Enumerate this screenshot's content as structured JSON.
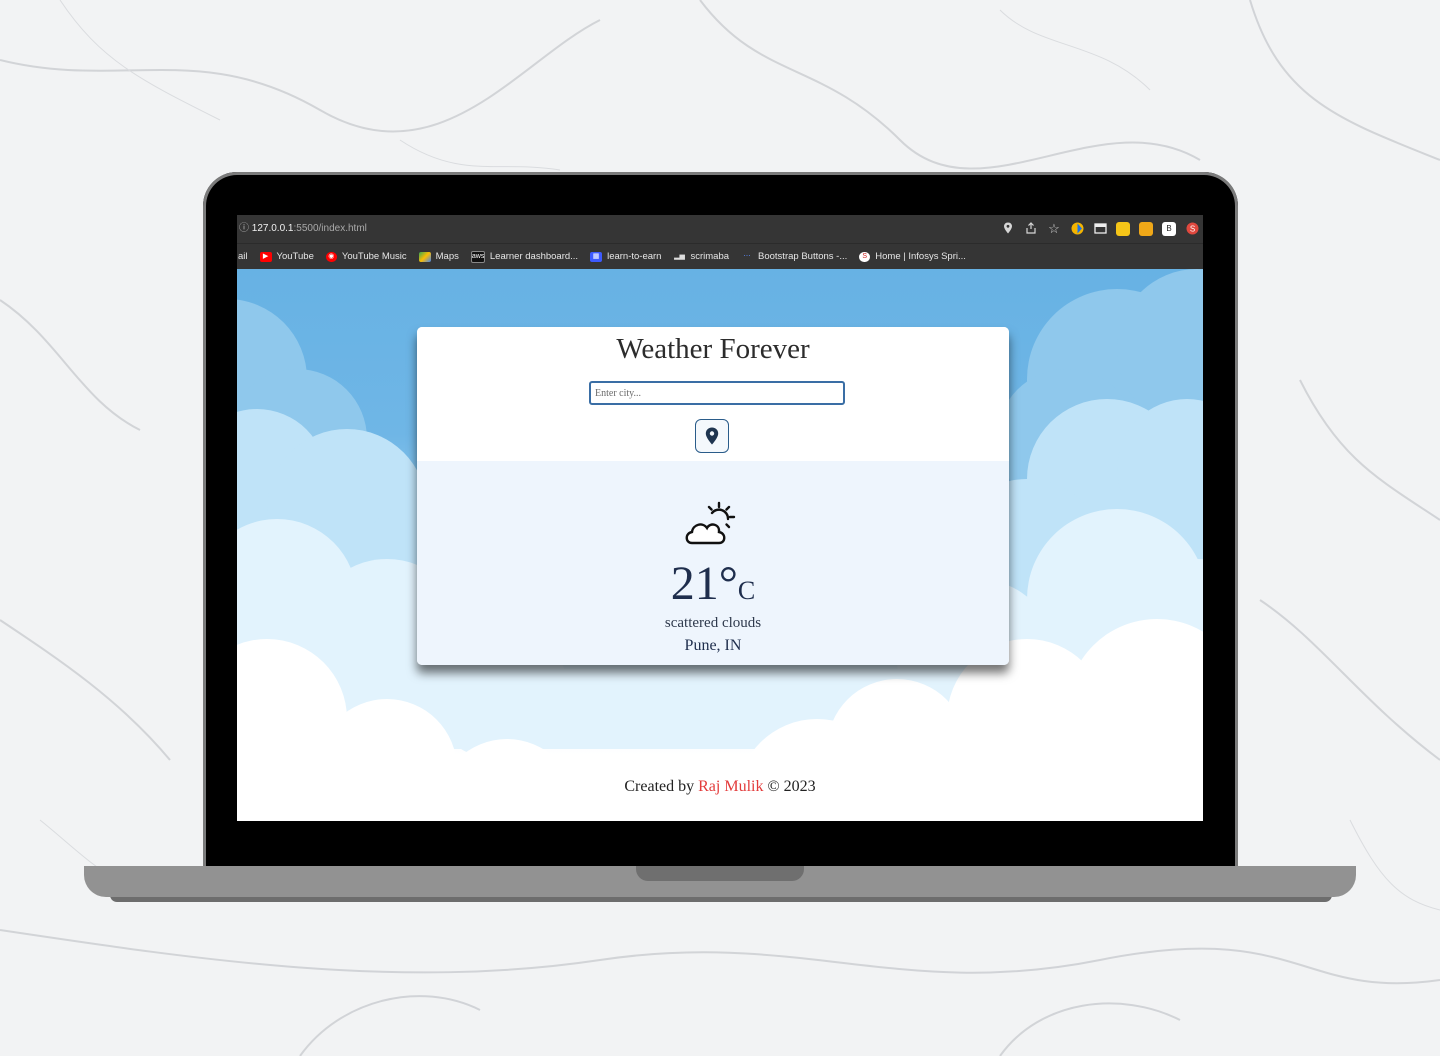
{
  "browser": {
    "url_host": "127.0.0.1",
    "url_path": ":5500/index.html",
    "bookmarks": [
      {
        "label": "ail",
        "color": "#353535"
      },
      {
        "label": "YouTube",
        "color": "#ff0000"
      },
      {
        "label": "YouTube Music",
        "color": "#ff0000"
      },
      {
        "label": "Maps",
        "color": "#34a853"
      },
      {
        "label": "Learner dashboard...",
        "color": "#111111"
      },
      {
        "label": "learn-to-earn",
        "color": "#3d5afe"
      },
      {
        "label": "scrimaba",
        "color": "#555555"
      },
      {
        "label": "Bootstrap Buttons -...",
        "color": "#3b82f6"
      },
      {
        "label": "Home | Infosys Spri...",
        "color": "#e0e0e0"
      }
    ],
    "extensions": [
      {
        "name": "location-icon",
        "glyph": "⬤"
      },
      {
        "name": "share-icon",
        "glyph": "⇪"
      },
      {
        "name": "star-icon",
        "glyph": "☆"
      }
    ]
  },
  "app": {
    "title": "Weather Forever",
    "search_placeholder": "Enter city...",
    "temperature": "21",
    "degree_symbol": "°",
    "unit": "C",
    "description": "scattered clouds",
    "location": "Pune, IN"
  },
  "footer": {
    "prefix": "Created by",
    "author": "Raj Mulik",
    "suffix": "© 2023"
  },
  "colors": {
    "sky": "#67b2e4",
    "author": "#e33b3b",
    "card_bottom": "#eef5fd"
  }
}
